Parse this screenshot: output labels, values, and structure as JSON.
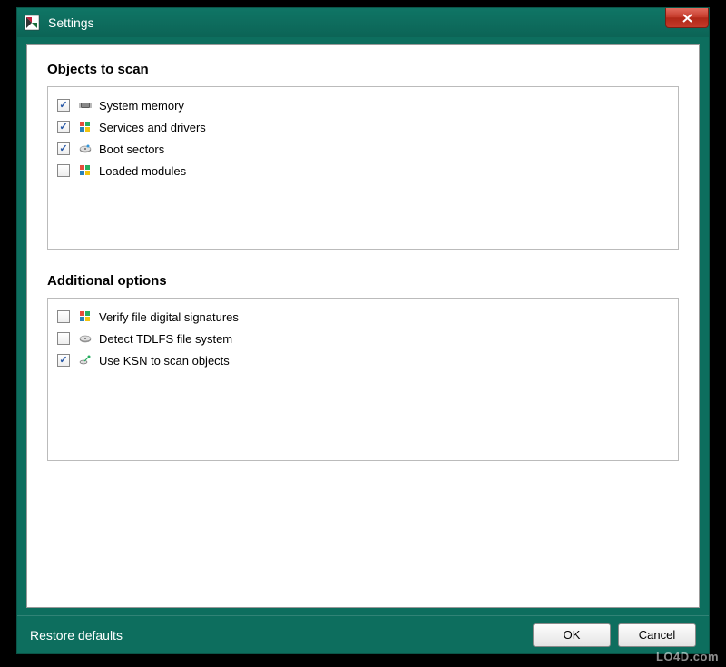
{
  "window": {
    "title": "Settings"
  },
  "sections": {
    "objects": {
      "title": "Objects to scan",
      "items": [
        {
          "label": "System memory",
          "checked": true,
          "icon": "chip"
        },
        {
          "label": "Services and drivers",
          "checked": true,
          "icon": "winflag"
        },
        {
          "label": "Boot sectors",
          "checked": true,
          "icon": "drive"
        },
        {
          "label": "Loaded modules",
          "checked": false,
          "icon": "winflag"
        }
      ]
    },
    "additional": {
      "title": "Additional options",
      "items": [
        {
          "label": "Verify file digital signatures",
          "checked": false,
          "icon": "winflag"
        },
        {
          "label": "Detect TDLFS file system",
          "checked": false,
          "icon": "drive"
        },
        {
          "label": "Use KSN to scan objects",
          "checked": true,
          "icon": "satellite"
        }
      ]
    }
  },
  "footer": {
    "restore": "Restore defaults",
    "ok": "OK",
    "cancel": "Cancel"
  },
  "watermark": "LO4D.com"
}
